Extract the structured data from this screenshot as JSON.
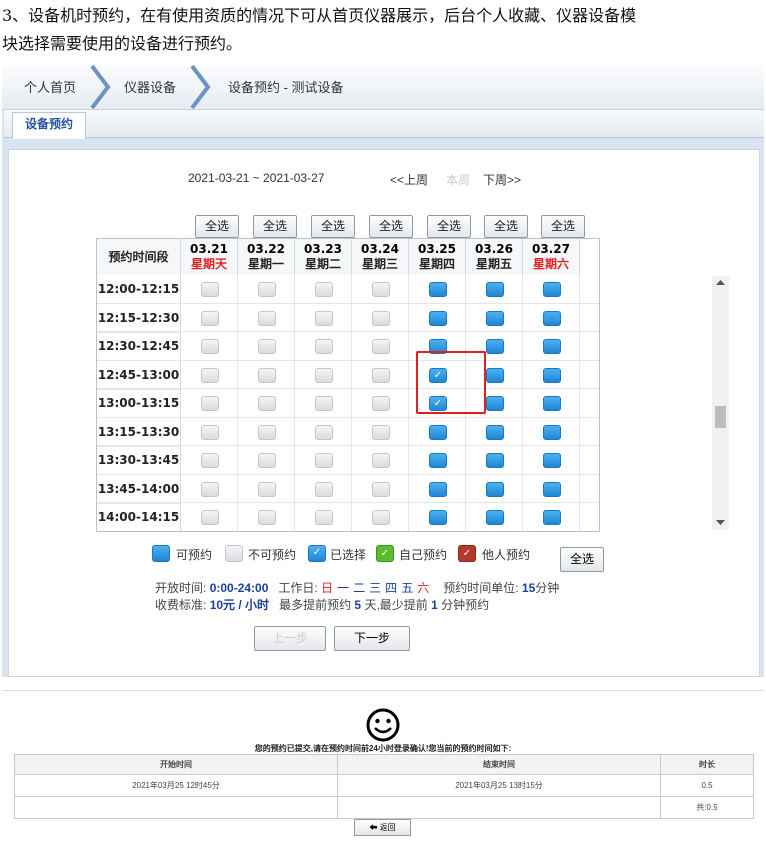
{
  "intro": {
    "line1": "3、设备机时预约，在有使用资质的情况下可从首页仪器展示，后台个人收藏、仪器设备模",
    "line2": "块选择需要使用的设备进行预约。"
  },
  "breadcrumb": [
    "个人首页",
    "仪器设备",
    "设备预约 - 测试设备"
  ],
  "tab": "设备预约",
  "week": {
    "range": "2021-03-21 ~ 2021-03-27",
    "prev": "<<上周",
    "current": "本周",
    "next": "下周>>"
  },
  "select_all": "全选",
  "corner": "预约时间段",
  "days": [
    {
      "date": "03.21",
      "weekday": "星期天",
      "weekend": true
    },
    {
      "date": "03.22",
      "weekday": "星期一",
      "weekend": false
    },
    {
      "date": "03.23",
      "weekday": "星期二",
      "weekend": false
    },
    {
      "date": "03.24",
      "weekday": "星期三",
      "weekend": false
    },
    {
      "date": "03.25",
      "weekday": "星期四",
      "weekend": false
    },
    {
      "date": "03.26",
      "weekday": "星期五",
      "weekend": false
    },
    {
      "date": "03.27",
      "weekday": "星期六",
      "weekend": true
    }
  ],
  "slots": [
    {
      "time": "12:00-12:15",
      "states": [
        "n",
        "n",
        "n",
        "n",
        "a",
        "a",
        "a"
      ]
    },
    {
      "time": "12:15-12:30",
      "states": [
        "n",
        "n",
        "n",
        "n",
        "a",
        "a",
        "a"
      ]
    },
    {
      "time": "12:30-12:45",
      "states": [
        "n",
        "n",
        "n",
        "n",
        "a",
        "a",
        "a"
      ]
    },
    {
      "time": "12:45-13:00",
      "states": [
        "n",
        "n",
        "n",
        "n",
        "s",
        "a",
        "a"
      ]
    },
    {
      "time": "13:00-13:15",
      "states": [
        "n",
        "n",
        "n",
        "n",
        "s",
        "a",
        "a"
      ]
    },
    {
      "time": "13:15-13:30",
      "states": [
        "n",
        "n",
        "n",
        "n",
        "a",
        "a",
        "a"
      ]
    },
    {
      "time": "13:30-13:45",
      "states": [
        "n",
        "n",
        "n",
        "n",
        "a",
        "a",
        "a"
      ]
    },
    {
      "time": "13:45-14:00",
      "states": [
        "n",
        "n",
        "n",
        "n",
        "a",
        "a",
        "a"
      ]
    },
    {
      "time": "14:00-14:15",
      "states": [
        "n",
        "n",
        "n",
        "n",
        "a",
        "a",
        "a"
      ]
    }
  ],
  "legend": {
    "available": "可预约",
    "unavailable": "不可预约",
    "selected": "已选择",
    "own": "自己预约",
    "others": "他人预约"
  },
  "info": {
    "open_label": "开放时间:",
    "open_value": "0:00-24:00",
    "workday_label": "工作日:",
    "workdays": [
      "日",
      "一",
      "二",
      "三",
      "四",
      "五",
      "六"
    ],
    "unit_label": "预约时间单位:",
    "unit_value": "15",
    "unit_suffix": "分钟",
    "fee_label": "收费标准:",
    "fee_value": "10元 / 小时",
    "advance_prefix": "最多提前预约",
    "advance_days": "5",
    "advance_mid": "天,最少提前",
    "advance_min": "1",
    "advance_suffix": "分钟预约"
  },
  "buttons": {
    "prev": "上一步",
    "next": "下一步"
  },
  "confirm": {
    "message": "您的预约已提交,请在预约时间前24小时登录确认!您当前的预约时间如下:",
    "headers": [
      "开始时间",
      "结束时间",
      "时长"
    ],
    "row": [
      "2021年03月25 12时45分",
      "2021年03月25 13时15分",
      "0.5"
    ],
    "total": "共:0.5",
    "back": "返回"
  },
  "colors": {
    "accent": "#1f86d3",
    "weekend": "#e0201f",
    "highlight": "#e0201f"
  }
}
